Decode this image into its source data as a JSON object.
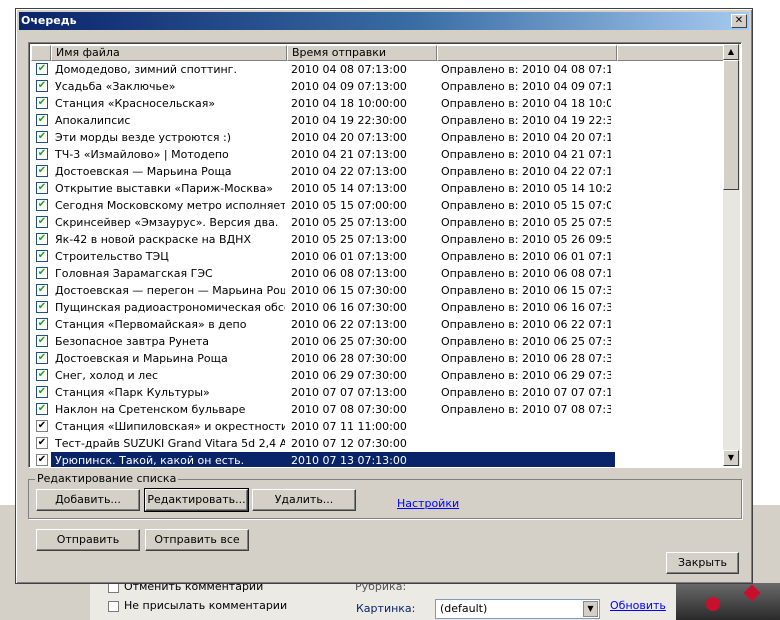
{
  "dialog": {
    "title": "Очередь",
    "close_glyph": "✕"
  },
  "list": {
    "columns": [
      "Имя файла",
      "Время отправки",
      ""
    ],
    "rows": [
      {
        "name": "Домодедово, зимний споттинг.",
        "time": "2010 04 08 07:13:00",
        "status": "Оправлено в: 2010 04 08 07:1...",
        "checked": true
      },
      {
        "name": "Усадьба «Заключье»",
        "time": "2010 04 09 07:13:00",
        "status": "Оправлено в: 2010 04 09 07:1...",
        "checked": true
      },
      {
        "name": "Станция «Красносельская»",
        "time": "2010 04 18 10:00:00",
        "status": "Оправлено в: 2010 04 18 10:0...",
        "checked": true
      },
      {
        "name": "Апокалипсис",
        "time": "2010 04 19 22:30:00",
        "status": "Оправлено в: 2010 04 19 22:3...",
        "checked": true
      },
      {
        "name": "Эти морды везде устроются :)",
        "time": "2010 04 20 07:13:00",
        "status": "Оправлено в: 2010 04 20 07:1...",
        "checked": true
      },
      {
        "name": "ТЧ-3 «Измайлово» | Мотодепо",
        "time": "2010 04 21 07:13:00",
        "status": "Оправлено в: 2010 04 21 07:1...",
        "checked": true
      },
      {
        "name": "Достоевская — Марьина Роща",
        "time": "2010 04 22 07:13:00",
        "status": "Оправлено в: 2010 04 22 07:1...",
        "checked": true
      },
      {
        "name": "Открытие выставки «Париж-Москва»",
        "time": "2010 05 14 07:13:00",
        "status": "Оправлено в: 2010 05 14 10:2...",
        "checked": true
      },
      {
        "name": "Сегодня Московскому метро исполняется...",
        "time": "2010 05 15 07:00:00",
        "status": "Оправлено в: 2010 05 15 07:0...",
        "checked": true
      },
      {
        "name": "Скринсейвер «Эмзаурус». Версия два.",
        "time": "2010 05 25 07:13:00",
        "status": "Оправлено в: 2010 05 25 07:5...",
        "checked": true
      },
      {
        "name": "Як-42 в новой раскраске на ВДНХ",
        "time": "2010 05 25 07:13:00",
        "status": "Оправлено в: 2010 05 26 09:5...",
        "checked": true
      },
      {
        "name": "Строительство ТЭЦ",
        "time": "2010 06 01 07:13:00",
        "status": "Оправлено в: 2010 06 01 07:1...",
        "checked": true
      },
      {
        "name": "Головная Зарамагская ГЭС",
        "time": "2010 06 08 07:13:00",
        "status": "Оправлено в: 2010 06 08 07:1...",
        "checked": true
      },
      {
        "name": "Достоевская — перегон — Марьина Рощ...",
        "time": "2010 06 15 07:30:00",
        "status": "Оправлено в: 2010 06 15 07:3...",
        "checked": true
      },
      {
        "name": "Пущинская радиоастрономическая обсер...",
        "time": "2010 06 16 07:30:00",
        "status": "Оправлено в: 2010 06 16 07:3...",
        "checked": true
      },
      {
        "name": "Станция «Первомайская» в депо",
        "time": "2010 06 22 07:13:00",
        "status": "Оправлено в: 2010 06 22 07:1...",
        "checked": true
      },
      {
        "name": "Безопасное завтра Рунета",
        "time": "2010 06 25 07:30:00",
        "status": "Оправлено в: 2010 06 25 07:3...",
        "checked": true
      },
      {
        "name": "Достоевская и Марьина Роща",
        "time": "2010 06 28 07:30:00",
        "status": "Оправлено в: 2010 06 28 07:3...",
        "checked": true
      },
      {
        "name": "Снег, холод и лес",
        "time": "2010 06 29 07:30:00",
        "status": "Оправлено в: 2010 06 29 07:3...",
        "checked": true
      },
      {
        "name": "Станция «Парк Культуры»",
        "time": "2010 07 07 07:13:00",
        "status": "Оправлено в: 2010 07 07 07:1...",
        "checked": true
      },
      {
        "name": "Наклон на Сретенском бульваре",
        "time": "2010 07 08 07:30:00",
        "status": "Оправлено в: 2010 07 08 07:3...",
        "checked": true
      },
      {
        "name": "Станция «Шипиловская» и окрестности.",
        "time": "2010 07 11 11:00:00",
        "status": "",
        "checked": true,
        "plain": true
      },
      {
        "name": "Тест-драйв SUZUKI Grand Vitara 5d 2,4 AT",
        "time": "2010 07 12 07:30:00",
        "status": "",
        "checked": true,
        "plain": true
      },
      {
        "name": "Урюпинск. Такой, какой он есть.",
        "time": "2010 07 13 07:13:00",
        "status": "",
        "checked": true,
        "plain": true,
        "selected": true
      }
    ]
  },
  "edit_group": {
    "label": "Редактирование списка",
    "add": "Добавить...",
    "edit": "Редактировать...",
    "delete": "Удалить...",
    "settings_link": "Настройки"
  },
  "actions": {
    "send": "Отправить",
    "send_all": "Отправить все",
    "close": "Закрыть"
  },
  "background": {
    "cancel_comments": "Отменить комментарии",
    "no_comments": "Не присылать комментарии",
    "picture_label": "Картинка:",
    "picture_value": "(default)",
    "refresh_link": "Обновить",
    "partial_label": "Рубрика:"
  },
  "colors": {
    "selection": "#0a246a",
    "check": "#21a121",
    "link": "#0000ff"
  }
}
